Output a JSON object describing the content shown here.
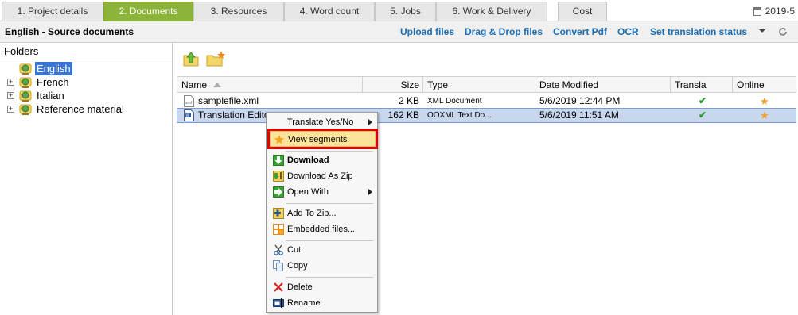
{
  "tabs": [
    {
      "label": "1. Project details",
      "active": false
    },
    {
      "label": "2. Documents",
      "active": true
    },
    {
      "label": "3. Resources",
      "active": false
    },
    {
      "label": "4. Word count",
      "active": false
    },
    {
      "label": "5. Jobs",
      "active": false
    },
    {
      "label": "6. Work & Delivery",
      "active": false
    },
    {
      "label": "Cost",
      "active": false
    }
  ],
  "version_label": "2019-5",
  "header": {
    "title": "English - Source documents",
    "actions": {
      "upload": "Upload files",
      "dragdrop": "Drag & Drop files",
      "convert": "Convert Pdf",
      "ocr": "OCR",
      "status": "Set translation status"
    }
  },
  "folders": {
    "title": "Folders",
    "items": [
      {
        "label": "English",
        "selected": true,
        "expandable": false
      },
      {
        "label": "French",
        "selected": false,
        "expandable": true
      },
      {
        "label": "Italian",
        "selected": false,
        "expandable": true
      },
      {
        "label": "Reference material",
        "selected": false,
        "expandable": true
      }
    ]
  },
  "table": {
    "columns": {
      "name": "Name",
      "size": "Size",
      "type": "Type",
      "modified": "Date Modified",
      "transla": "Transla",
      "online": "Online"
    },
    "rows": [
      {
        "name": "samplefile.xml",
        "size": "2 KB",
        "type": "XML Document",
        "modified": "5/6/2019 12:44 PM",
        "transla": "✔",
        "online": "★"
      },
      {
        "name": "Translation Edito",
        "size": "162 KB",
        "type": "OOXML Text Do...",
        "modified": "5/6/2019 11:51 AM",
        "transla": "✔",
        "online": "★"
      }
    ]
  },
  "context_menu": {
    "translate": "Translate Yes/No",
    "view_segments": "View segments",
    "download": "Download",
    "download_zip": "Download As Zip",
    "open_with": "Open With",
    "add_zip": "Add To Zip...",
    "embedded": "Embedded files...",
    "cut": "Cut",
    "copy": "Copy",
    "delete": "Delete",
    "rename": "Rename"
  },
  "colors": {
    "active_tab": "#8db43a",
    "link": "#1a6fb5",
    "selection": "#3875d7",
    "highlight_outline": "#e00000"
  }
}
